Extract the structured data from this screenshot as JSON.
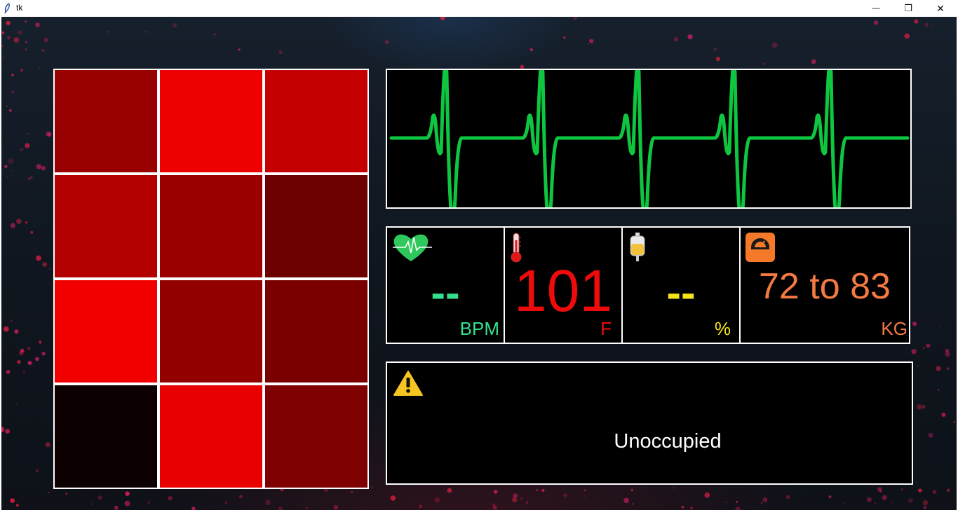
{
  "window": {
    "title": "tk",
    "controls": {
      "minimize": "—",
      "maximize": "❐",
      "close": "✕"
    }
  },
  "sensor_grid": {
    "rows": 4,
    "cols": 3,
    "cells": [
      [
        "#990000",
        "#ef0000",
        "#c40000"
      ],
      [
        "#b30000",
        "#9b0000",
        "#6d0000"
      ],
      [
        "#f20000",
        "#930000",
        "#7a0000"
      ],
      [
        "#0c0000",
        "#e80000",
        "#7f0000"
      ]
    ]
  },
  "ecg": {
    "color": "#0fc640",
    "beats": 5,
    "icon": "ecg-waveform"
  },
  "vitals": {
    "heart_rate": {
      "value": "--",
      "unit": "BPM",
      "color": "#33e08e",
      "icon": "heart-pulse-icon"
    },
    "temperature": {
      "value": "101",
      "unit": "F",
      "color": "#ef0b0b",
      "icon": "thermometer-icon"
    },
    "fluid": {
      "value": "--",
      "unit": "%",
      "color": "#f4e41a",
      "icon": "iv-bag-icon"
    },
    "weight": {
      "value": "72 to 83",
      "unit": "KG",
      "color": "#f47a42",
      "icon": "scale-icon"
    }
  },
  "alert": {
    "icon": "warning-icon",
    "status": "Unoccupied"
  }
}
